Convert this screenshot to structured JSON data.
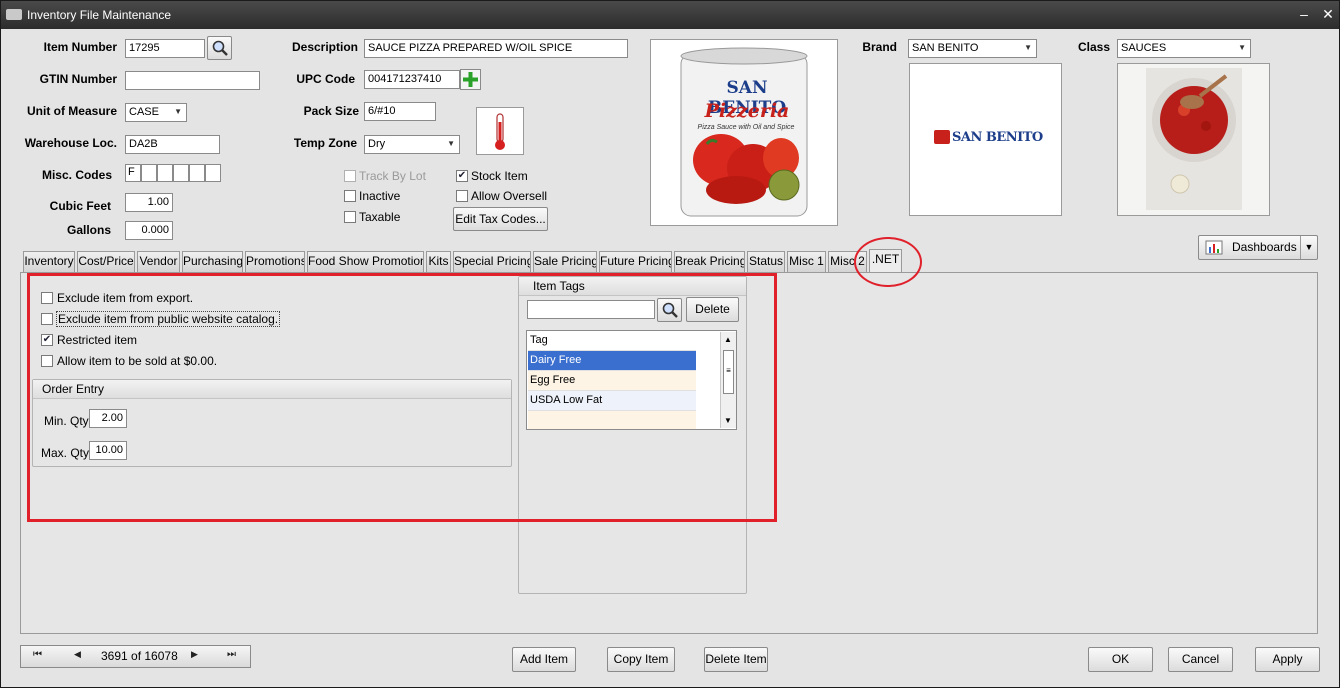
{
  "window": {
    "title": "Inventory File Maintenance",
    "minimize": "–",
    "close": "✕"
  },
  "form": {
    "item_number": {
      "label": "Item Number",
      "value": "17295"
    },
    "gtin": {
      "label": "GTIN Number",
      "value": ""
    },
    "uom": {
      "label": "Unit of Measure",
      "value": "CASE"
    },
    "warehouse": {
      "label": "Warehouse Loc.",
      "value": "DA2B"
    },
    "misc_codes": {
      "label": "Misc. Codes",
      "values": [
        "F",
        "",
        "",
        "",
        "",
        ""
      ]
    },
    "cubic_feet": {
      "label": "Cubic Feet",
      "value": "1.00"
    },
    "gallons": {
      "label": "Gallons",
      "value": "0.000"
    },
    "description": {
      "label": "Description",
      "value": "SAUCE PIZZA PREPARED W/OIL SPICE"
    },
    "upc": {
      "label": "UPC Code",
      "value": "004171237410"
    },
    "pack_size": {
      "label": "Pack Size",
      "value": "6/#10"
    },
    "temp_zone": {
      "label": "Temp Zone",
      "value": "Dry"
    },
    "brand": {
      "label": "Brand",
      "value": "SAN BENITO"
    },
    "class": {
      "label": "Class",
      "value": "SAUCES"
    },
    "flags": [
      {
        "label": "Track By Lot",
        "checked": false,
        "disabled": true
      },
      {
        "label": "Stock Item",
        "checked": true,
        "disabled": false
      },
      {
        "label": "Inactive",
        "checked": false,
        "disabled": false
      },
      {
        "label": "Allow Oversell",
        "checked": false,
        "disabled": false
      },
      {
        "label": "Taxable",
        "checked": false,
        "disabled": false
      }
    ],
    "edit_tax_codes": "Edit Tax Codes..."
  },
  "product_image": {
    "brand_text": "SAN BENITO",
    "product_text": "Pizzeria",
    "sub_text": "Pizza Sauce with Oil and Spice"
  },
  "brand_logo": {
    "text": "SAN BENITO"
  },
  "dashboards": "Dashboards",
  "tabs": [
    "Inventory",
    "Cost/Price",
    "Vendor",
    "Purchasing",
    "Promotions",
    "Food Show Promotions",
    "Kits",
    "Special Pricing",
    "Sale Pricing",
    "Future Pricing",
    "Break Pricing",
    "Status",
    "Misc 1",
    "Misc 2",
    ".NET"
  ],
  "active_tab": ".NET",
  "net_tab": {
    "options": [
      {
        "label": "Exclude item from export.",
        "checked": false
      },
      {
        "label": "Exclude item from public website catalog.",
        "checked": false
      },
      {
        "label": "Restricted item",
        "checked": true
      },
      {
        "label": "Allow item to be sold at $0.00.",
        "checked": false
      }
    ],
    "order_entry": {
      "title": "Order Entry",
      "min_label": "Min. Qty",
      "min_value": "2.00",
      "max_label": "Max. Qty",
      "max_value": "10.00"
    },
    "item_tags": {
      "title": "Item Tags",
      "search_value": "",
      "delete_label": "Delete",
      "column": "Tag",
      "rows": [
        "Dairy Free",
        "Egg Free",
        "USDA Low Fat"
      ]
    }
  },
  "navigator": {
    "first": "⏮",
    "prev": "◀",
    "position": "3691 of 16078",
    "next": "▶",
    "last": "⏭"
  },
  "actions": {
    "add": "Add Item",
    "copy": "Copy Item",
    "delete": "Delete Item",
    "ok": "OK",
    "cancel": "Cancel",
    "apply": "Apply"
  },
  "colors": {
    "highlight": "#e0202a",
    "selection": "#3a6fcf",
    "titlebar": "#2c2c2c"
  }
}
